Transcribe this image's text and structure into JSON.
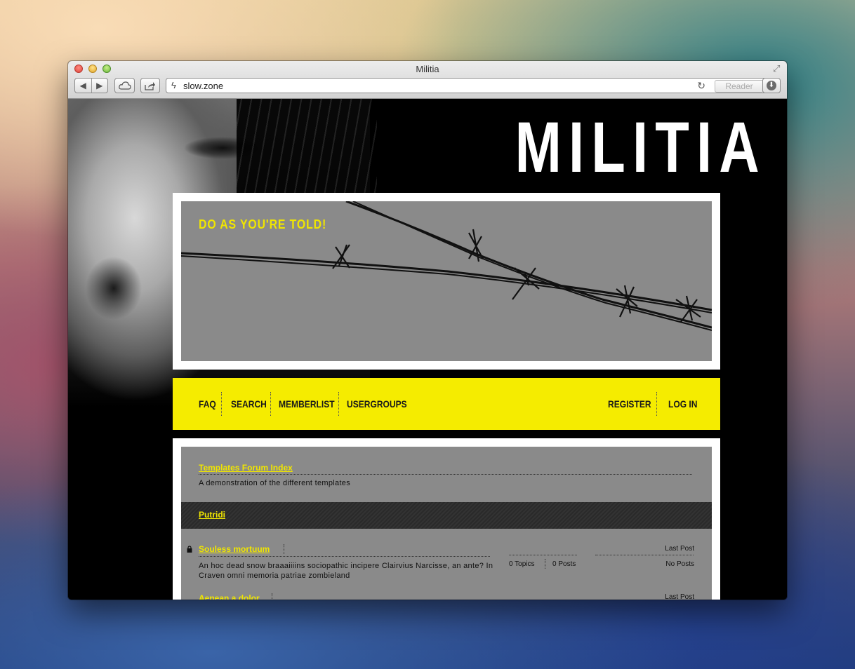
{
  "browser": {
    "window_title": "Militia",
    "url": "slow.zone",
    "reader_label": "Reader",
    "icons": [
      "back-icon",
      "forward-icon",
      "icloud-icon",
      "share-icon",
      "site-icon",
      "reload-icon",
      "download-icon",
      "fullscreen-icon"
    ]
  },
  "site": {
    "logo": "MILITIA",
    "tagline": "DO AS YOU'RE TOLD!",
    "accent_color": "#f5ec00"
  },
  "nav": {
    "left": [
      "FAQ",
      "SEARCH",
      "MEMBERLIST",
      "USERGROUPS"
    ],
    "right": [
      "REGISTER",
      "LOG IN"
    ]
  },
  "content": {
    "breadcrumb": "Templates Forum Index",
    "description": "A demonstration of the different templates",
    "category": "Putridi",
    "forums": [
      {
        "name": "Souless mortuum",
        "description": "An hoc dead snow braaaiiiins sociopathic incipere Clairvius Narcisse, an ante? In Craven omni memoria patriae zombieland",
        "topics": "0 Topics",
        "posts": "0 Posts",
        "last_post_label": "Last Post",
        "last_post_value": "No Posts"
      },
      {
        "name": "Aenean a dolor",
        "last_post_label": "Last Post"
      }
    ]
  }
}
